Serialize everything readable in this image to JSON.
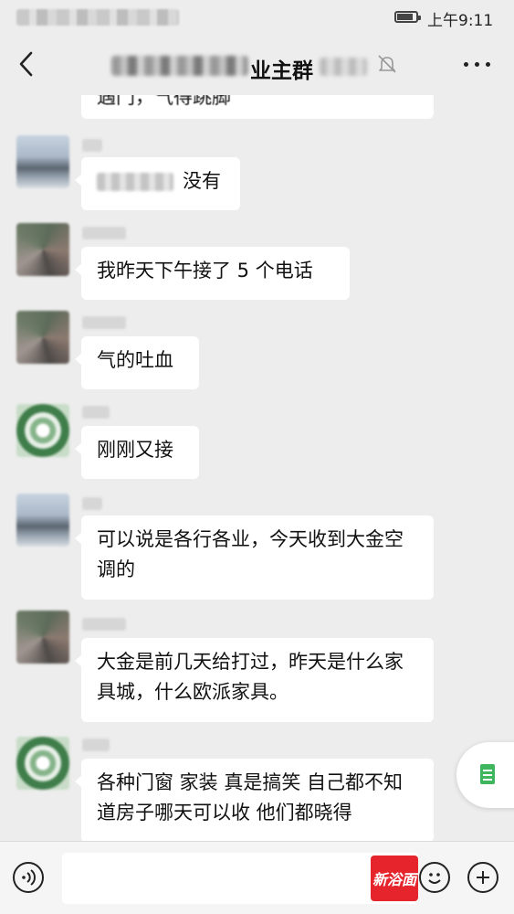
{
  "status_bar": {
    "time": "上午9:11"
  },
  "header": {
    "title_visible": "业主群"
  },
  "messages": [
    {
      "text": "遇门，气得跳脚"
    },
    {
      "mention": "",
      "text": "没有"
    },
    {
      "text": "我昨天下午接了 5 个电话"
    },
    {
      "text": "气的吐血"
    },
    {
      "text": "刚刚又接"
    },
    {
      "text": "可以说是各行各业，今天收到大金空调的"
    },
    {
      "text": "大金是前几天给打过，昨天是什么家具城，什么欧派家具。"
    },
    {
      "text": "各种门窗 家装 真是搞笑 自己都不知道房子哪天可以收 他们都晓得"
    }
  ],
  "input": {
    "placeholder": ""
  },
  "watermark": {
    "text": "新浴面"
  },
  "icons": [
    "back-icon",
    "mute-bell-icon",
    "more-icon",
    "voice-icon",
    "emoji-icon",
    "plus-icon",
    "document-icon",
    "battery-icon"
  ]
}
